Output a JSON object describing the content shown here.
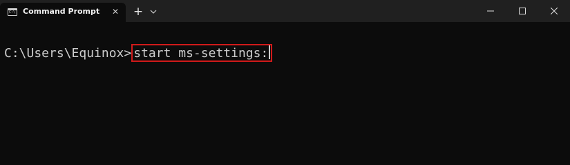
{
  "window": {
    "tab_title": "Command Prompt",
    "tab_icon": "cmd-icon",
    "tab_icon_glyph": "C:\\",
    "close_tab_glyph": "✕",
    "new_tab_glyph": "+",
    "controls": {
      "minimize": "minimize-icon",
      "maximize": "maximize-icon",
      "close": "close-icon"
    }
  },
  "terminal": {
    "prompt": "C:\\Users\\Equinox>",
    "command": "start ms-settings:",
    "highlight_color": "#d11a1a",
    "text_color": "#cccccc",
    "background": "#0c0c0c"
  }
}
